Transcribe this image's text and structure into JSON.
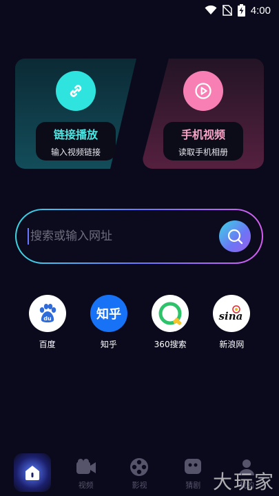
{
  "status_bar": {
    "time": "4:00",
    "icons": [
      "wifi-icon",
      "no-sim-icon",
      "battery-charging-icon"
    ]
  },
  "cards": {
    "link_play": {
      "title": "链接播放",
      "subtitle": "输入视频链接",
      "icon": "link-icon",
      "accent": "#2fe3de"
    },
    "local_video": {
      "title": "手机视频",
      "subtitle": "读取手机相册",
      "icon": "play-icon",
      "accent": "#f87fb4"
    }
  },
  "search": {
    "placeholder": "搜索或输入网址",
    "value": "",
    "icon": "search-icon"
  },
  "quick_links": [
    {
      "label": "百度",
      "icon": "baidu-icon"
    },
    {
      "label": "知乎",
      "icon": "zhihu-icon"
    },
    {
      "label": "360搜索",
      "icon": "360-search-icon"
    },
    {
      "label": "新浪网",
      "icon": "sina-icon"
    }
  ],
  "bottom_nav": [
    {
      "label": "",
      "icon": "home-icon",
      "active": true
    },
    {
      "label": "视频",
      "icon": "video-camera-icon"
    },
    {
      "label": "影视",
      "icon": "film-reel-icon"
    },
    {
      "label": "猜剧",
      "icon": "guess-icon"
    },
    {
      "label": "我的",
      "icon": "profile-icon"
    }
  ],
  "watermark": "大玩家",
  "colors": {
    "background": "#0b0a1c",
    "cyan": "#2fe3de",
    "pink": "#f87fb4",
    "search_gradient": [
      "#3ad7e2",
      "#6a78ff",
      "#d65ef0"
    ]
  }
}
